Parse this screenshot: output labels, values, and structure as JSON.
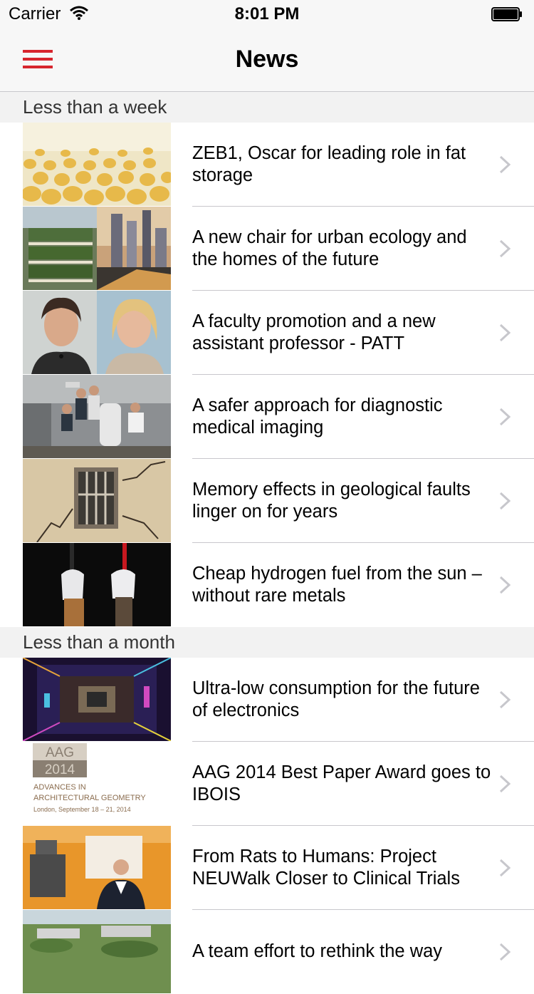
{
  "status_bar": {
    "carrier": "Carrier",
    "time": "8:01 PM",
    "icons": [
      "wifi-icon",
      "battery-icon"
    ]
  },
  "nav": {
    "title": "News",
    "menu_icon": "menu-icon",
    "accent_color": "#d7262e"
  },
  "sections": [
    {
      "header": "Less than a week",
      "items": [
        {
          "title": "ZEB1, Oscar for leading role in fat storage"
        },
        {
          "title": "A new chair for urban ecology and the homes of the future"
        },
        {
          "title": "A faculty promotion and a new assistant professor - PATT"
        },
        {
          "title": "A safer approach for diagnostic medical imaging"
        },
        {
          "title": "Memory effects in geological faults linger on for years"
        },
        {
          "title": "Cheap hydrogen fuel from the sun – without rare metals"
        }
      ]
    },
    {
      "header": "Less than a month",
      "items": [
        {
          "title": "Ultra-low consumption for the future of electronics"
        },
        {
          "title": "AAG 2014 Best Paper Award goes to IBOIS",
          "thumb_text": {
            "top": "AAG",
            "bottom": "2014",
            "line1": "ADVANCES IN",
            "line2": "ARCHITECTURAL GEOMETRY",
            "line3": "London, September 18 – 21, 2014"
          }
        },
        {
          "title": "From Rats to Humans: Project NEUWalk Closer to Clinical Trials"
        },
        {
          "title": "A team effort to rethink the way"
        }
      ]
    }
  ]
}
